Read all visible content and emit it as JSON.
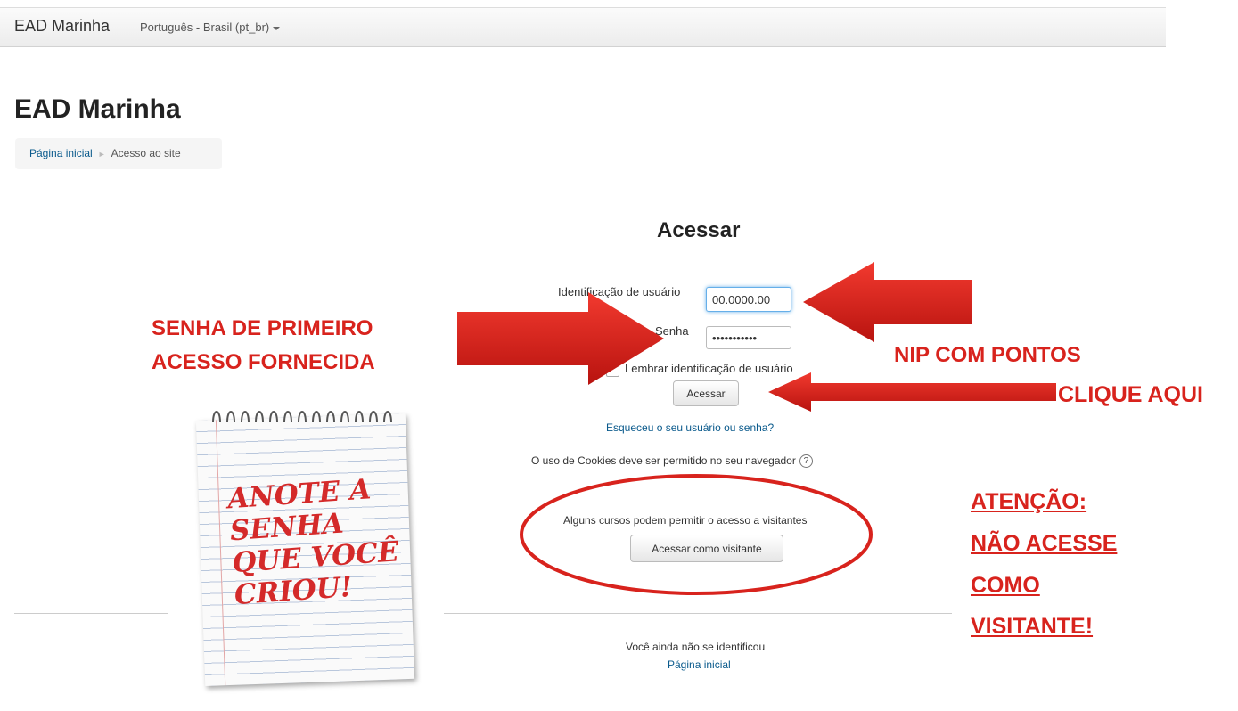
{
  "navbar": {
    "brand": "EAD Marinha",
    "language": "Português - Brasil (pt_br)"
  },
  "page_title": "EAD Marinha",
  "breadcrumb": {
    "home": "Página inicial",
    "separator": "►",
    "current": "Acesso ao site"
  },
  "login": {
    "title": "Acessar",
    "username_label": "Identificação de usuário",
    "username_value": "00.0000.00",
    "password_label": "Senha",
    "password_value": "•••••••••••",
    "remember_label": "Lembrar identificação de usuário",
    "submit_label": "Acessar",
    "forgot_link": "Esqueceu o seu usuário ou senha?",
    "cookies_text": "O uso de Cookies deve ser permitido no seu navegador",
    "help_icon": "?",
    "guest_text": "Alguns cursos podem permitir o acesso a visitantes",
    "guest_button": "Acessar como visitante"
  },
  "footer": {
    "status": "Você ainda não se identificou",
    "home_link": "Página inicial"
  },
  "annotations": {
    "first_password_line1": "SENHA DE PRIMEIRO",
    "first_password_line2": "ACESSO FORNECIDA",
    "nip": "NIP COM PONTOS",
    "click_here": "CLIQUE AQUI",
    "warning_line1": "ATENÇÃO:",
    "warning_line2": "NÃO ACESSE",
    "warning_line3": "COMO",
    "warning_line4": "VISITANTE!",
    "note_line1": "ANOTE A",
    "note_line2": "SENHA",
    "note_line3": "QUE VOCÊ",
    "note_line4": "CRIOU!"
  },
  "colors": {
    "annotation_red": "#d8231d",
    "link_blue": "#0a5a8c"
  }
}
